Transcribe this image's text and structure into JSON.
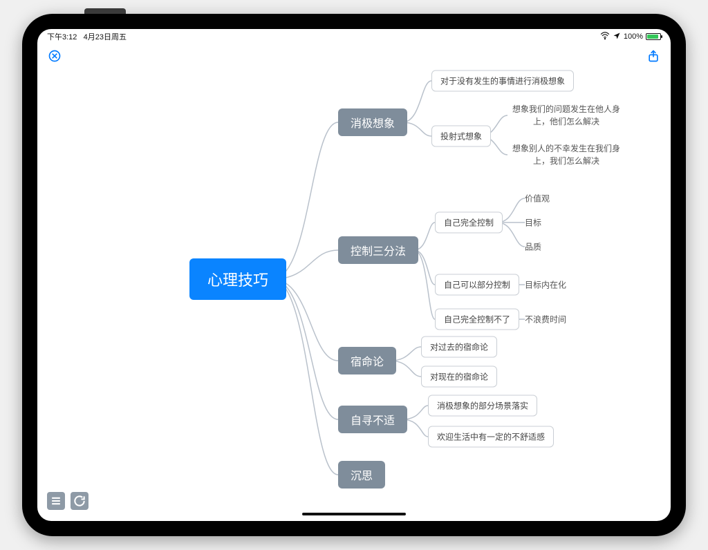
{
  "status": {
    "time": "下午3:12",
    "date": "4月23日周五",
    "battery_pct": "100%"
  },
  "toolbar": {
    "close": "关闭",
    "share": "分享",
    "list": "列表",
    "refresh": "刷新"
  },
  "mindmap": {
    "root": "心理技巧",
    "b1": {
      "label": "消极想象",
      "l1": "对于没有发生的事情进行消极想象",
      "l2": "投射式想象",
      "l2a": "想象我们的问题发生在他人身上，他们怎么解决",
      "l2b": "想象别人的不幸发生在我们身上，我们怎么解决"
    },
    "b2": {
      "label": "控制三分法",
      "l1": "自己完全控制",
      "l1a": "价值观",
      "l1b": "目标",
      "l1c": "品质",
      "l2": "自己可以部分控制",
      "l2a": "目标内在化",
      "l3": "自己完全控制不了",
      "l3a": "不浪费时间"
    },
    "b3": {
      "label": "宿命论",
      "l1": "对过去的宿命论",
      "l2": "对现在的宿命论"
    },
    "b4": {
      "label": "自寻不适",
      "l1": "消极想象的部分场景落实",
      "l2": "欢迎生活中有一定的不舒适感"
    },
    "b5": {
      "label": "沉思"
    }
  }
}
